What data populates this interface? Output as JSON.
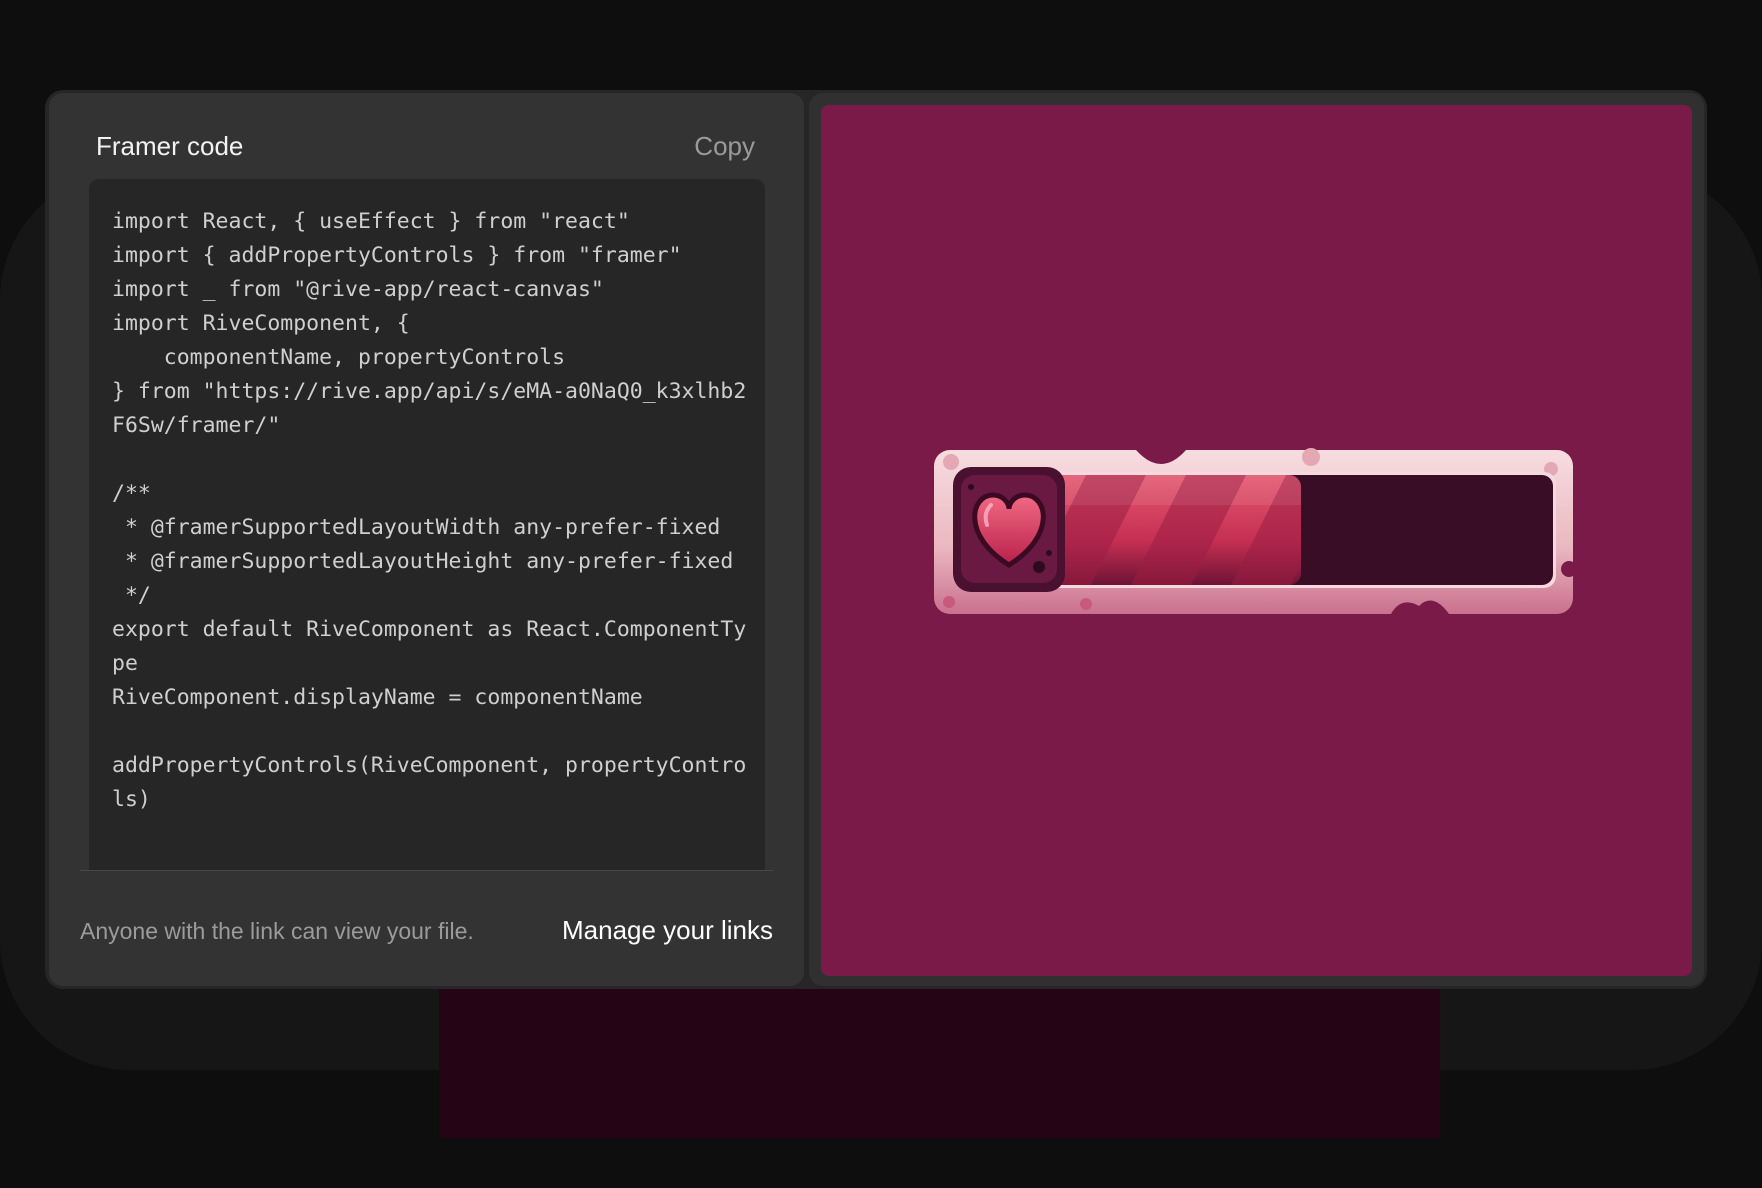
{
  "panel": {
    "title": "Framer code",
    "copy_label": "Copy"
  },
  "code": {
    "content": "import React, { useEffect } from \"react\"\nimport { addPropertyControls } from \"framer\"\nimport _ from \"@rive-app/react-canvas\"\nimport RiveComponent, {\n    componentName, propertyControls\n} from \"https://rive.app/api/s/eMA-a0NaQ0_k3xlhb2F6Sw/framer/\"\n\n/**\n * @framerSupportedLayoutWidth any-prefer-fixed\n * @framerSupportedLayoutHeight any-prefer-fixed\n */\nexport default RiveComponent as React.ComponentType\nRiveComponent.displayName = componentName\n\naddPropertyControls(RiveComponent, propertyControls)"
  },
  "footer": {
    "note": "Anyone with the link can view your file.",
    "manage_links_label": "Manage your links"
  },
  "preview": {
    "icon": "heart-icon",
    "health_fill": 0.55,
    "colors": {
      "background": "#7a1a48",
      "frame": "#f2c6cc",
      "fill": "#d5365a",
      "empty": "#3a0d26"
    }
  }
}
